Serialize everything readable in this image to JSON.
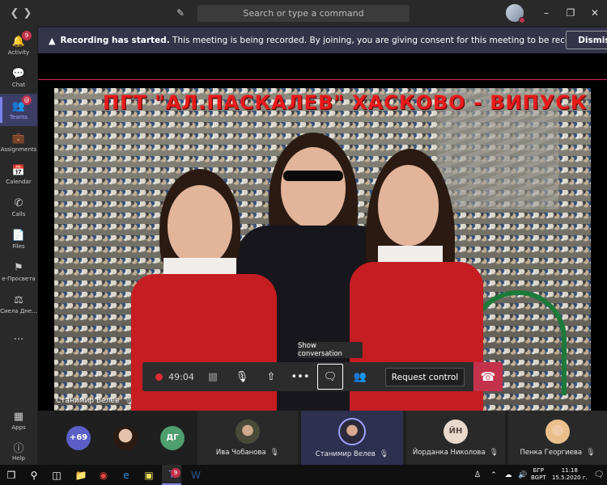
{
  "search": {
    "placeholder": "Search or type a command"
  },
  "rail": [
    {
      "label": "Activity",
      "badge": "9"
    },
    {
      "label": "Chat",
      "badge": ""
    },
    {
      "label": "Teams",
      "badge": "@"
    },
    {
      "label": "Assignments",
      "badge": ""
    },
    {
      "label": "Calendar",
      "badge": ""
    },
    {
      "label": "Calls",
      "badge": ""
    },
    {
      "label": "Files",
      "badge": ""
    },
    {
      "label": "е-Просвета",
      "badge": ""
    },
    {
      "label": "Сиела Дне...",
      "badge": ""
    },
    {
      "label": "...",
      "badge": ""
    }
  ],
  "rail_bottom": [
    {
      "label": "Apps"
    },
    {
      "label": "Help"
    }
  ],
  "banner": {
    "title": "Recording has started.",
    "message": "This meeting is being recorded. By joining, you are giving consent for this meeting to be recorded. Pr...",
    "dismiss": "Dismiss"
  },
  "shared_screen": {
    "photo_title": "ПГТ \"АЛ.ПАСКАЛЕВ\" ХАСКОВО - ВИПУСК 2020"
  },
  "controls": {
    "timer": "49:04",
    "tooltip": "Show conversation",
    "request_control": "Request control"
  },
  "presenter": {
    "name": "Станимир Велев"
  },
  "participants": [
    {
      "initials": "+69",
      "color": "#5b5fc7",
      "name": ""
    },
    {
      "initials": "",
      "color": "#7a5a4a",
      "name": ""
    },
    {
      "initials": "ДГ",
      "color": "#4f9e6e",
      "name": ""
    },
    {
      "initials": "",
      "color": "#6b6b5a",
      "name": "Ива Чобанова"
    },
    {
      "initials": "",
      "color": "#3a3a5a",
      "name": "Станимир Велев"
    },
    {
      "initials": "ЙН",
      "color": "#ead8cd",
      "name": "Йорданка Николова"
    },
    {
      "initials": "",
      "color": "#e9c08c",
      "name": "Пенка Георгиева"
    }
  ],
  "taskbar": {
    "teams_badge": "9",
    "lang_top": "БГР",
    "lang_bottom": "BGPT",
    "time": "11:18",
    "date": "15.5.2020 г."
  },
  "colors": {
    "accent": "#7b83eb",
    "alert": "#c4314b",
    "rail_bg": "#292929",
    "banner_bg": "#33344a"
  }
}
